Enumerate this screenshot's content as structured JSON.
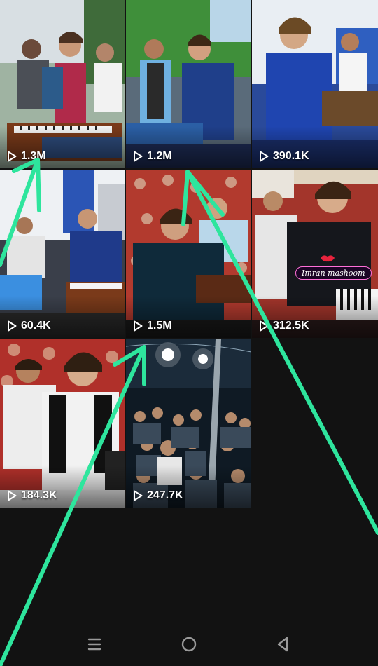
{
  "grid": {
    "items": [
      {
        "views": "1.3M",
        "thumbnail": "boy-playing-harmonium-red-vest"
      },
      {
        "views": "1.2M",
        "thumbnail": "boy-singing-blue-outfit-outdoors"
      },
      {
        "views": "390.1K",
        "thumbnail": "boy-blue-outfit-harmonium"
      },
      {
        "views": "60.4K",
        "thumbnail": "stage-musicians-harmonium"
      },
      {
        "views": "1.5M",
        "thumbnail": "boy-black-outfit-harmonium-red-wall"
      },
      {
        "views": "312.5K",
        "thumbnail": "boy-playing-keyboard-black-outfit"
      },
      {
        "views": "184.3K",
        "thumbnail": "boy-white-outfit-black-vest"
      },
      {
        "views": "247.7K",
        "thumbnail": "night-crowd-event"
      }
    ],
    "play_icon": "play-outline-icon"
  },
  "watermark": {
    "text": "Imran mashoom",
    "icon": "lips-icon"
  },
  "annotation": {
    "color": "#2ee59d"
  },
  "navbar": {
    "recents_icon": "recents-icon",
    "home_icon": "home-icon",
    "back_icon": "back-icon"
  },
  "colors": {
    "background": "#121212",
    "nav_icon": "#9a9a9a",
    "annotation_arrow": "#2ee59d"
  }
}
